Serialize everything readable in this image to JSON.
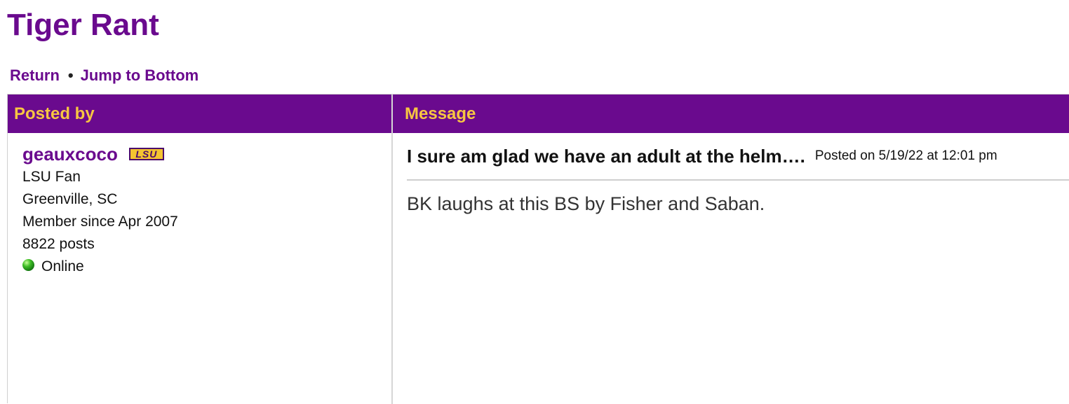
{
  "board": {
    "title": "Tiger Rant"
  },
  "nav": {
    "return_label": "Return",
    "separator": "•",
    "jump_label": "Jump to Bottom"
  },
  "table": {
    "header_posted_by": "Posted by",
    "header_message": "Message"
  },
  "poster": {
    "username": "geauxcoco",
    "team_logo_text": "LSU",
    "fan_of": "LSU Fan",
    "location": "Greenville, SC",
    "member_since": "Member since Apr 2007",
    "posts": "8822 posts",
    "status": "Online",
    "status_icon": "green-dot-icon"
  },
  "message": {
    "subject": "I sure am glad we have an adult at the helm….",
    "posted_on": "Posted on 5/19/22 at 12:01 pm",
    "body": "BK laughs at this BS by Fisher and Saban."
  },
  "colors": {
    "brand_purple": "#6a0a8e",
    "header_gold": "#f7c642",
    "online_green": "#3fbd26"
  }
}
